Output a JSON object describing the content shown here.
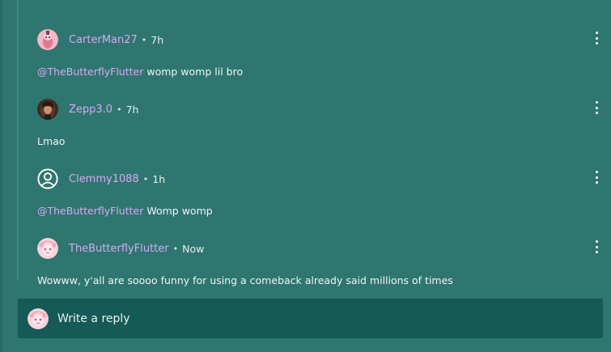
{
  "thread": {
    "comments": [
      {
        "username": "CarterMan27",
        "separator": "•",
        "time": "7h",
        "mention": "@TheButterflyFlutter",
        "text": " womp womp lil bro",
        "avatar_icon": "pink-character-avatar"
      },
      {
        "username": "Zepp3.0",
        "separator": "•",
        "time": "7h",
        "mention": "",
        "text": "Lmao",
        "avatar_icon": "dark-hair-avatar"
      },
      {
        "username": "Clemmy1088",
        "separator": "•",
        "time": "1h",
        "mention": "@TheButterflyFlutter",
        "text": " Womp womp",
        "avatar_icon": "default-user-avatar"
      },
      {
        "username": "TheButterflyFlutter",
        "separator": "•",
        "time": "Now",
        "mention": "",
        "text": "Wowww, y'all are soooo funny for using a comeback already said millions of times",
        "avatar_icon": "pink-anime-avatar"
      }
    ]
  },
  "reply": {
    "placeholder": "Write a reply"
  },
  "colors": {
    "background": "#2f7670",
    "reply_box": "#155a56",
    "username": "#d7a9f2",
    "text": "#eef5f3"
  }
}
